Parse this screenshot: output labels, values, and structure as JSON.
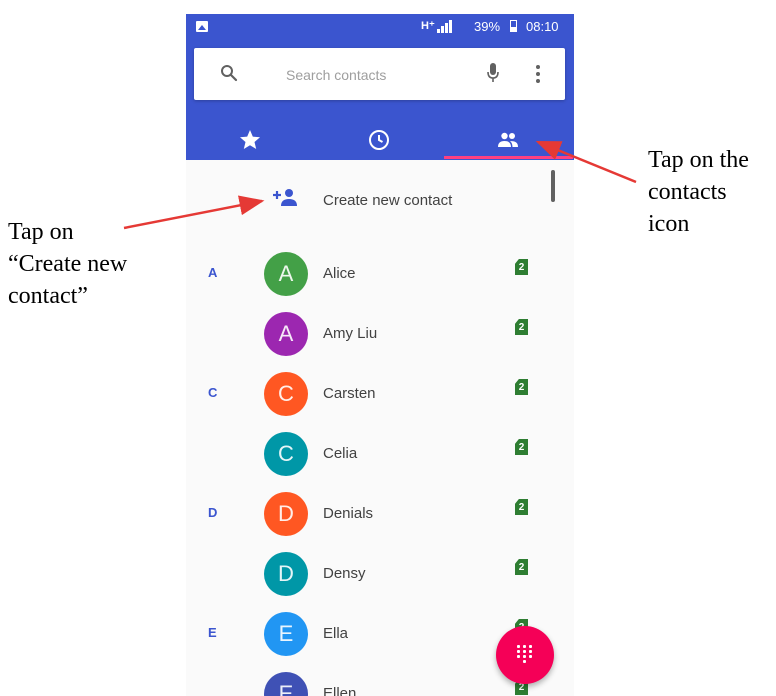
{
  "status_bar": {
    "network": "H⁺",
    "battery_percent": "39%",
    "battery_level": 0.39,
    "time": "08:10"
  },
  "search": {
    "placeholder": "Search contacts",
    "icons": [
      "search-icon",
      "mic-icon",
      "more-vert-icon"
    ]
  },
  "tabs": [
    {
      "name": "favorites",
      "icon": "star-icon",
      "selected": false
    },
    {
      "name": "recents",
      "icon": "clock-icon",
      "selected": false
    },
    {
      "name": "contacts",
      "icon": "people-icon",
      "selected": true
    }
  ],
  "create_contact": {
    "label": "Create new contact",
    "icon": "add-person-icon"
  },
  "contacts": [
    {
      "letter": "A",
      "initial": "A",
      "name": "Alice",
      "color": "#43a047"
    },
    {
      "letter": "",
      "initial": "A",
      "name": "Amy Liu",
      "color": "#9c27b0"
    },
    {
      "letter": "C",
      "initial": "C",
      "name": "Carsten",
      "color": "#ff5722"
    },
    {
      "letter": "",
      "initial": "C",
      "name": "Celia",
      "color": "#0097a7"
    },
    {
      "letter": "D",
      "initial": "D",
      "name": "Denials",
      "color": "#ff5722"
    },
    {
      "letter": "",
      "initial": "D",
      "name": "Densy",
      "color": "#0097a7"
    },
    {
      "letter": "E",
      "initial": "E",
      "name": "Ella",
      "color": "#2196f3"
    },
    {
      "letter": "",
      "initial": "E",
      "name": "Ellen",
      "color": "#3f51b5"
    }
  ],
  "sim_label": "2",
  "fab": {
    "icon": "dialpad-icon",
    "color": "#f50057"
  },
  "colors": {
    "appbar": "#3b55cf",
    "tab_indicator": "#ff4081",
    "section_letter": "#3b55cf",
    "arrow": "#e53935"
  },
  "annotations": {
    "left_lines": [
      "Tap on",
      "“Create new",
      "contact”"
    ],
    "right_lines": [
      "Tap on the",
      "contacts",
      "icon"
    ]
  }
}
